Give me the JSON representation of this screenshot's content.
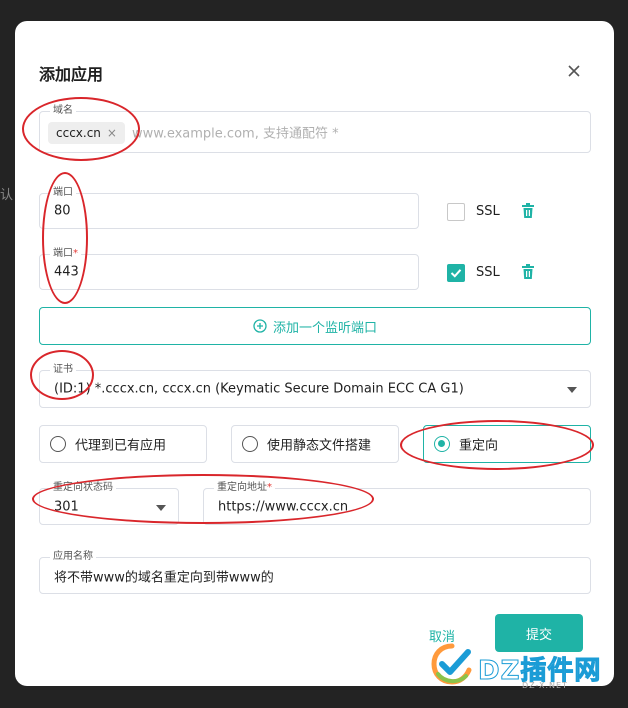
{
  "background": {
    "partial_text": "认"
  },
  "modal": {
    "title": "添加应用",
    "domain": {
      "label": "域名",
      "chip": "cccx.cn",
      "chip_remove": "×",
      "placeholder": "www.example.com, 支持通配符 *"
    },
    "ports": [
      {
        "label": "端口",
        "required": "",
        "value": "80",
        "ssl_label": "SSL",
        "ssl_checked": false
      },
      {
        "label": "端口",
        "required": "*",
        "value": "443",
        "ssl_label": "SSL",
        "ssl_checked": true
      }
    ],
    "add_port_label": "添加一个监听端口",
    "certificate": {
      "label": "证书",
      "value": "(ID:1) *.cccx.cn, cccx.cn (Keymatic Secure Domain ECC CA G1)"
    },
    "type_options": [
      {
        "label": "代理到已有应用",
        "selected": false
      },
      {
        "label": "使用静态文件搭建",
        "selected": false
      },
      {
        "label": "重定向",
        "selected": true
      }
    ],
    "redirect_code": {
      "label": "重定向状态码",
      "value": "301"
    },
    "redirect_url": {
      "label": "重定向地址",
      "required": "*",
      "value": "https://www.cccx.cn"
    },
    "app_name": {
      "label": "应用名称",
      "value": "将不带www的域名重定向到带www的"
    },
    "cancel_label": "取消",
    "submit_label": "提交"
  },
  "watermark": {
    "brand": "DZ插件网",
    "sub": "DZ-X.NET"
  },
  "colors": {
    "accent": "#1fb3a6",
    "annotation": "#d9262b",
    "required": "#e53935"
  },
  "icons": [
    "close-icon",
    "trash-icon",
    "plus-circle-icon",
    "check-icon",
    "dropdown-caret-icon",
    "watermark-logo-icon"
  ]
}
